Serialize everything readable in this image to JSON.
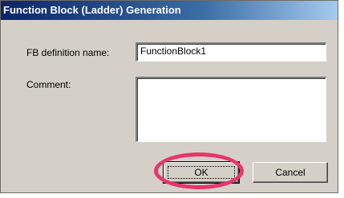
{
  "window": {
    "title": "Function Block (Ladder) Generation"
  },
  "form": {
    "fb_definition_label": "FB definition name:",
    "fb_definition_value": "FunctionBlock1",
    "comment_label": "Comment:",
    "comment_value": ""
  },
  "buttons": {
    "ok_label": "OK",
    "cancel_label": "Cancel"
  },
  "annotation": {
    "highlight_color": "#e8356b",
    "highlight_target": "ok-button"
  }
}
